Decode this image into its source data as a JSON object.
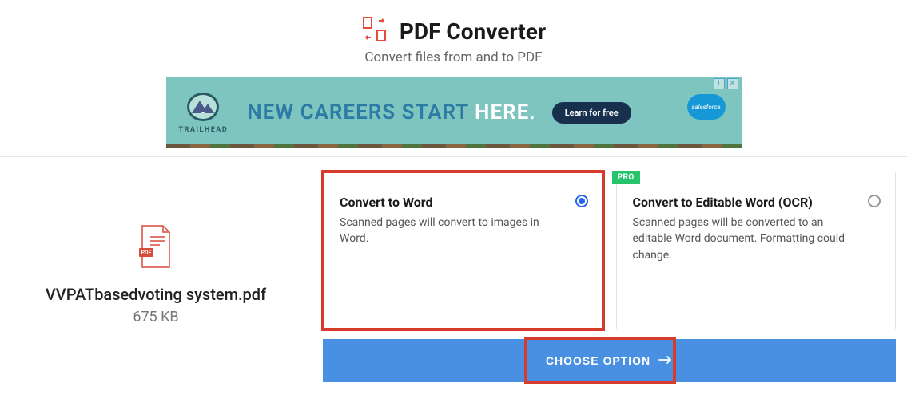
{
  "header": {
    "title": "PDF Converter",
    "subtitle": "Convert files from and to PDF"
  },
  "ad": {
    "brand": "TRAILHEAD",
    "line1": "NEW CAREERS START ",
    "accent": "HERE.",
    "cta": "Learn for free",
    "cloud": "salesforce"
  },
  "file": {
    "name": "VVPATbasedvoting system.pdf",
    "size": "675 KB"
  },
  "options": [
    {
      "title": "Convert to Word",
      "desc": "Scanned pages will convert to images in Word.",
      "selected": true,
      "pro": false
    },
    {
      "title": "Convert to Editable Word (OCR)",
      "desc": "Scanned pages will be converted to an editable Word document. Formatting could change.",
      "selected": false,
      "pro": true
    }
  ],
  "badge": {
    "pro": "PRO"
  },
  "action": {
    "choose": "CHOOSE OPTION"
  },
  "colors": {
    "accent": "#d63b2b",
    "primary": "#4a90e2",
    "pro": "#27c56b"
  }
}
